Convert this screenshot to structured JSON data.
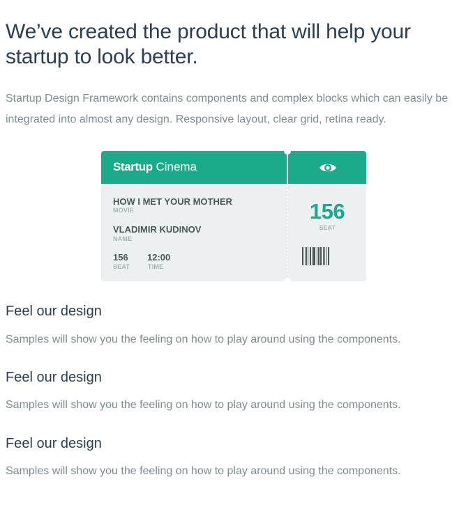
{
  "hero": {
    "headline": "We’ve created the product that will help your startup to look better.",
    "intro": "Startup Design Framework contains components and complex blocks which can easily be integrated into almost any design. Responsive layout, clear grid, retina ready."
  },
  "ticket": {
    "brand_bold": "Startup",
    "brand_light": "Cinema",
    "movie_title": "HOW I MET YOUR MOTHER",
    "movie_caption": "MOVIE",
    "name_value": "VLADIMIR KUDINOV",
    "name_caption": "NAME",
    "seat_value": "156",
    "seat_caption": "SEAT",
    "time_value": "12:00",
    "time_caption": "TIME",
    "stub_seat_value": "156",
    "stub_seat_caption": "SEAT",
    "accent_color": "#1bab8a",
    "stub_icon": "eye-icon"
  },
  "features": [
    {
      "title": "Feel our design",
      "text": "Samples will show you the feeling on how to play around using the components."
    },
    {
      "title": "Feel our design",
      "text": "Samples will show you the feeling on how to play around using the components."
    },
    {
      "title": "Feel our design",
      "text": "Samples will show you the feeling on how to play around using the components."
    }
  ]
}
